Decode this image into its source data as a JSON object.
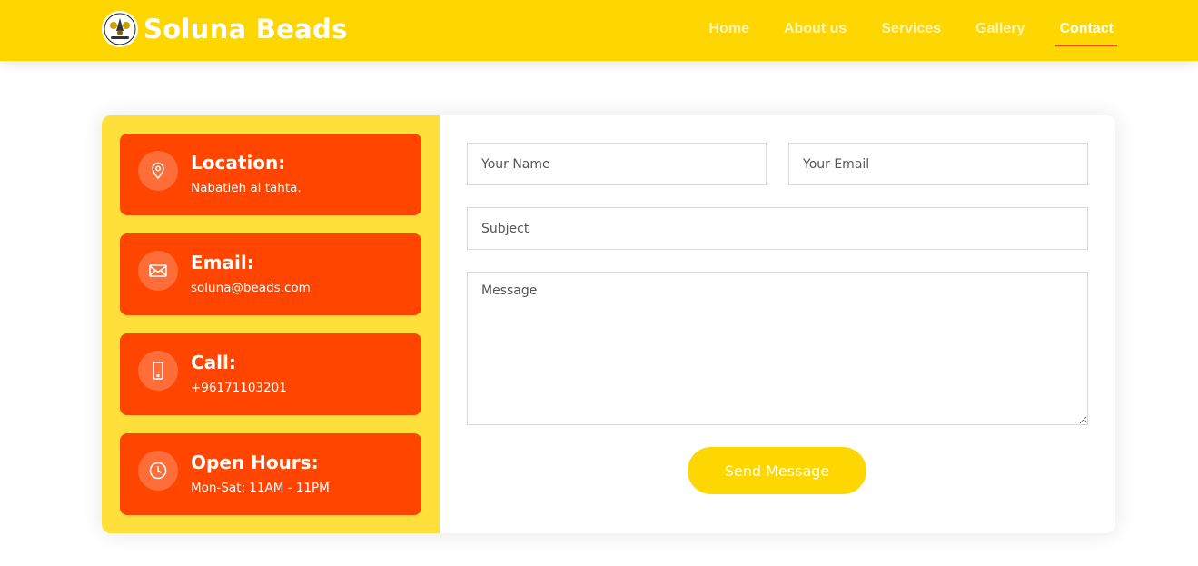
{
  "brand": {
    "name": "Soluna Beads",
    "logo_icon": "beads-logo-icon"
  },
  "nav": {
    "items": [
      {
        "label": "Home",
        "active": false
      },
      {
        "label": "About us",
        "active": false
      },
      {
        "label": "Services",
        "active": false
      },
      {
        "label": "Gallery",
        "active": false
      },
      {
        "label": "Contact",
        "active": true
      }
    ]
  },
  "info": {
    "location": {
      "title": "Location:",
      "text": "Nabatieh al tahta.",
      "icon": "map-pin-icon"
    },
    "email": {
      "title": "Email:",
      "text": "soluna@beads.com",
      "icon": "envelope-icon"
    },
    "call": {
      "title": "Call:",
      "text": "+96171103201",
      "icon": "phone-icon"
    },
    "hours": {
      "title": "Open Hours:",
      "text": "Mon-Sat: 11AM - 11PM",
      "icon": "clock-icon"
    }
  },
  "form": {
    "name_placeholder": "Your Name",
    "email_placeholder": "Your Email",
    "subject_placeholder": "Subject",
    "message_placeholder": "Message",
    "submit_label": "Send Message"
  },
  "colors": {
    "header_bg": "#ffd700",
    "info_panel_bg": "#ffe03a",
    "info_box_bg": "#ff4500",
    "accent_underline": "#ff4500",
    "button_bg": "#ffd700"
  }
}
